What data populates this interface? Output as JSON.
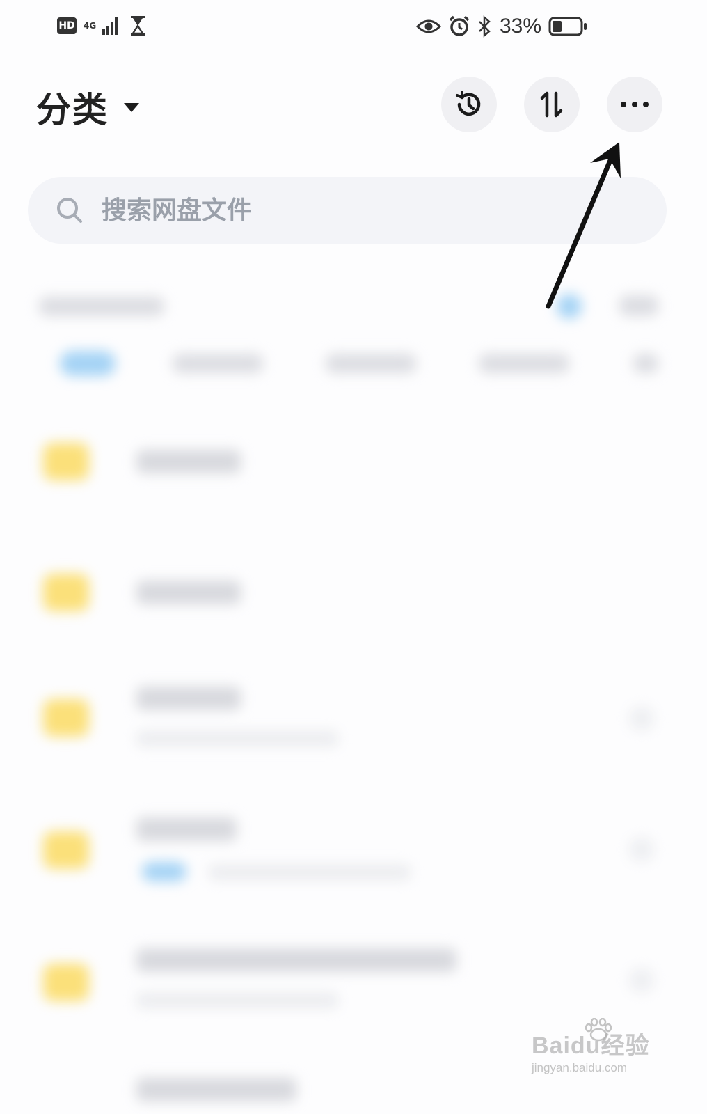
{
  "status_bar": {
    "hd_label": "HD",
    "network_label": "4G",
    "battery_percent": "33%",
    "battery_level": 0.33,
    "icons": [
      "signal-icon",
      "hourglass-icon",
      "eye-icon",
      "alarm-icon",
      "bluetooth-icon",
      "battery-icon"
    ]
  },
  "header": {
    "title": "分类",
    "buttons": [
      {
        "name": "history-button",
        "icon": "history-icon"
      },
      {
        "name": "transfer-button",
        "icon": "transfer-arrows-icon"
      },
      {
        "name": "more-button",
        "icon": "more-dots-icon"
      }
    ]
  },
  "search": {
    "placeholder": "搜索网盘文件",
    "icon": "search-icon"
  },
  "watermark": {
    "text": "Baidu经验",
    "sub": "jingyan.baidu.com"
  },
  "colors": {
    "background": "#fdfdfe",
    "button_bg": "#f0f0f3",
    "search_bg": "#f3f4f8",
    "placeholder": "#9aa0aa",
    "folder": "#fbe07a",
    "accent_blue": "#a5d3f5",
    "annotation_arrow": "#111111"
  }
}
